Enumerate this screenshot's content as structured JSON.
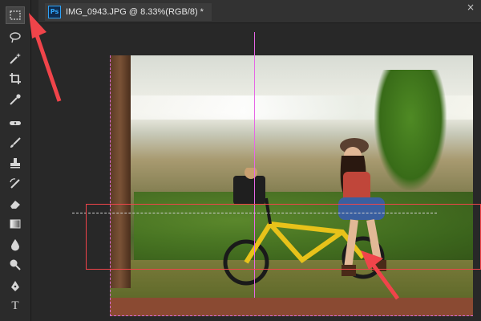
{
  "document": {
    "tab_title": "IMG_0943.JPG @ 8.33%(RGB/8) *",
    "app_badge": "Ps",
    "close_symbol": "×"
  },
  "toolbar": {
    "tools": [
      {
        "name": "rectangular-marquee-tool",
        "icon": "marquee-icon",
        "active": true
      },
      {
        "name": "lasso-tool",
        "icon": "lasso-icon"
      },
      {
        "name": "magic-wand-tool",
        "icon": "magic-wand-icon"
      },
      {
        "name": "crop-tool",
        "icon": "crop-icon"
      },
      {
        "name": "eyedropper-tool",
        "icon": "eyedropper-icon"
      },
      {
        "name": "healing-brush-tool",
        "icon": "healing-brush-icon"
      },
      {
        "name": "brush-tool",
        "icon": "brush-icon"
      },
      {
        "name": "clone-stamp-tool",
        "icon": "stamp-icon"
      },
      {
        "name": "history-brush-tool",
        "icon": "history-brush-icon"
      },
      {
        "name": "eraser-tool",
        "icon": "eraser-icon"
      },
      {
        "name": "gradient-tool",
        "icon": "gradient-icon"
      },
      {
        "name": "blur-tool",
        "icon": "blur-drop-icon"
      },
      {
        "name": "dodge-tool",
        "icon": "dodge-icon"
      },
      {
        "name": "pen-tool",
        "icon": "pen-icon"
      },
      {
        "name": "type-tool",
        "icon": "type-icon",
        "label": "T"
      }
    ]
  },
  "colors": {
    "accent_annotation": "#f0444a",
    "guide": "#e667e6",
    "ps_blue": "#31a8ff"
  }
}
